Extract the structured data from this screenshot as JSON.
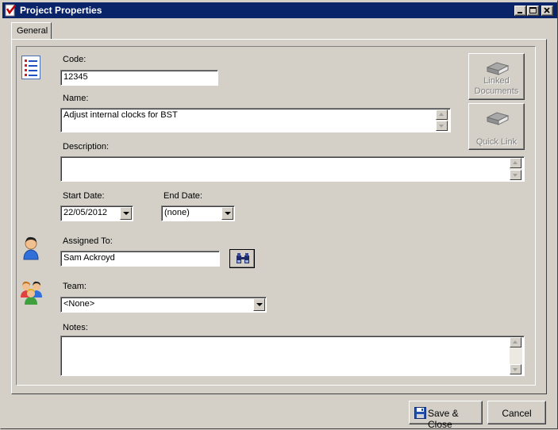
{
  "window": {
    "title": "Project Properties"
  },
  "tabs": [
    {
      "label": "General"
    }
  ],
  "form": {
    "code_label": "Code:",
    "code_value": "12345",
    "name_label": "Name:",
    "name_value": "Adjust internal clocks for BST",
    "description_label": "Description:",
    "description_value": "",
    "start_date_label": "Start Date:",
    "start_date_value": "22/05/2012",
    "end_date_label": "End Date:",
    "end_date_value": "(none)",
    "assigned_to_label": "Assigned To:",
    "assigned_to_value": "Sam Ackroyd",
    "team_label": "Team:",
    "team_value": "<None>",
    "notes_label": "Notes:",
    "notes_value": ""
  },
  "side_buttons": {
    "linked_documents_line1": "Linked",
    "linked_documents_line2": "Documents",
    "quick_link": "Quick Link"
  },
  "footer": {
    "save_close_label": "Save & Close",
    "cancel_label": "Cancel"
  },
  "icons": {
    "app": "app-icon",
    "list": "list-icon",
    "user": "user-icon",
    "team": "team-icon",
    "binoculars": "binoculars-icon",
    "book": "book-icon",
    "save": "floppy-disk-icon"
  },
  "colors": {
    "titlebar": "#0a246a",
    "face": "#d4d0c8"
  }
}
